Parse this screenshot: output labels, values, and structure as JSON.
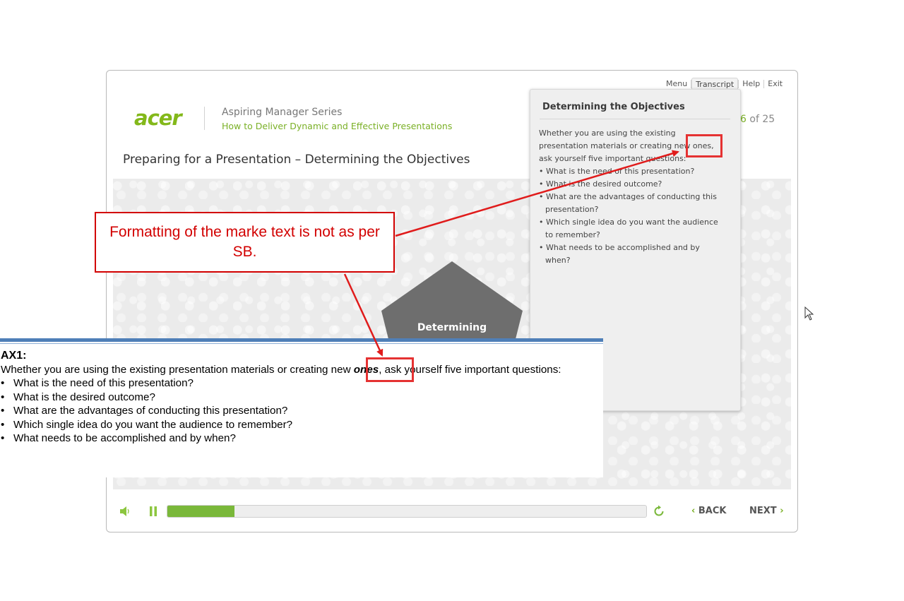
{
  "nav": {
    "menu": "Menu",
    "transcript": "Transcript",
    "help": "Help",
    "exit": "Exit"
  },
  "header": {
    "logo_text": "acer",
    "series": "Aspiring Manager Series",
    "course": "How to Deliver Dynamic and Effective Presentations",
    "page_current": "6",
    "page_of": "of 25"
  },
  "slide": {
    "title": "Preparing for a Presentation – Determining the Objectives",
    "shape_label": "Determining"
  },
  "transcript_panel": {
    "heading": "Determining the Objectives",
    "intro": "Whether you are using the existing presentation materials or creating new ones, ask yourself five important questions:",
    "bullets": [
      "• What is the need of this presentation?",
      "• What is the desired outcome?",
      "• What are the advantages of conducting this presentation?",
      "• Which single idea do you want the audience to remember?",
      "• What needs to be accomplished and by when?"
    ]
  },
  "controls": {
    "progress_fraction": 0.14,
    "back": "BACK",
    "next": "NEXT",
    "icons": [
      "speaker-icon",
      "pause-icon",
      "replay-icon"
    ]
  },
  "ax": {
    "heading": "AX1:",
    "intro_before": "Whether you are using the existing presentation materials or creating new ",
    "intro_emph": "ones",
    "intro_after": ", ask yourself five important questions:",
    "bullet_char": "•",
    "bullets": [
      "What is the need of this presentation?",
      "What is the desired outcome?",
      "What are the advantages of conducting this presentation?",
      "Which single idea do you want the audience to remember?",
      "What needs to be accomplished and by when?"
    ]
  },
  "annotation": {
    "callout": "Formatting of the marke text is not as per SB.",
    "color": "#d20000"
  },
  "colors": {
    "brand_green": "#7ab026",
    "progress_green": "#7ab83a",
    "shape_gray": "#6e6e6e"
  }
}
